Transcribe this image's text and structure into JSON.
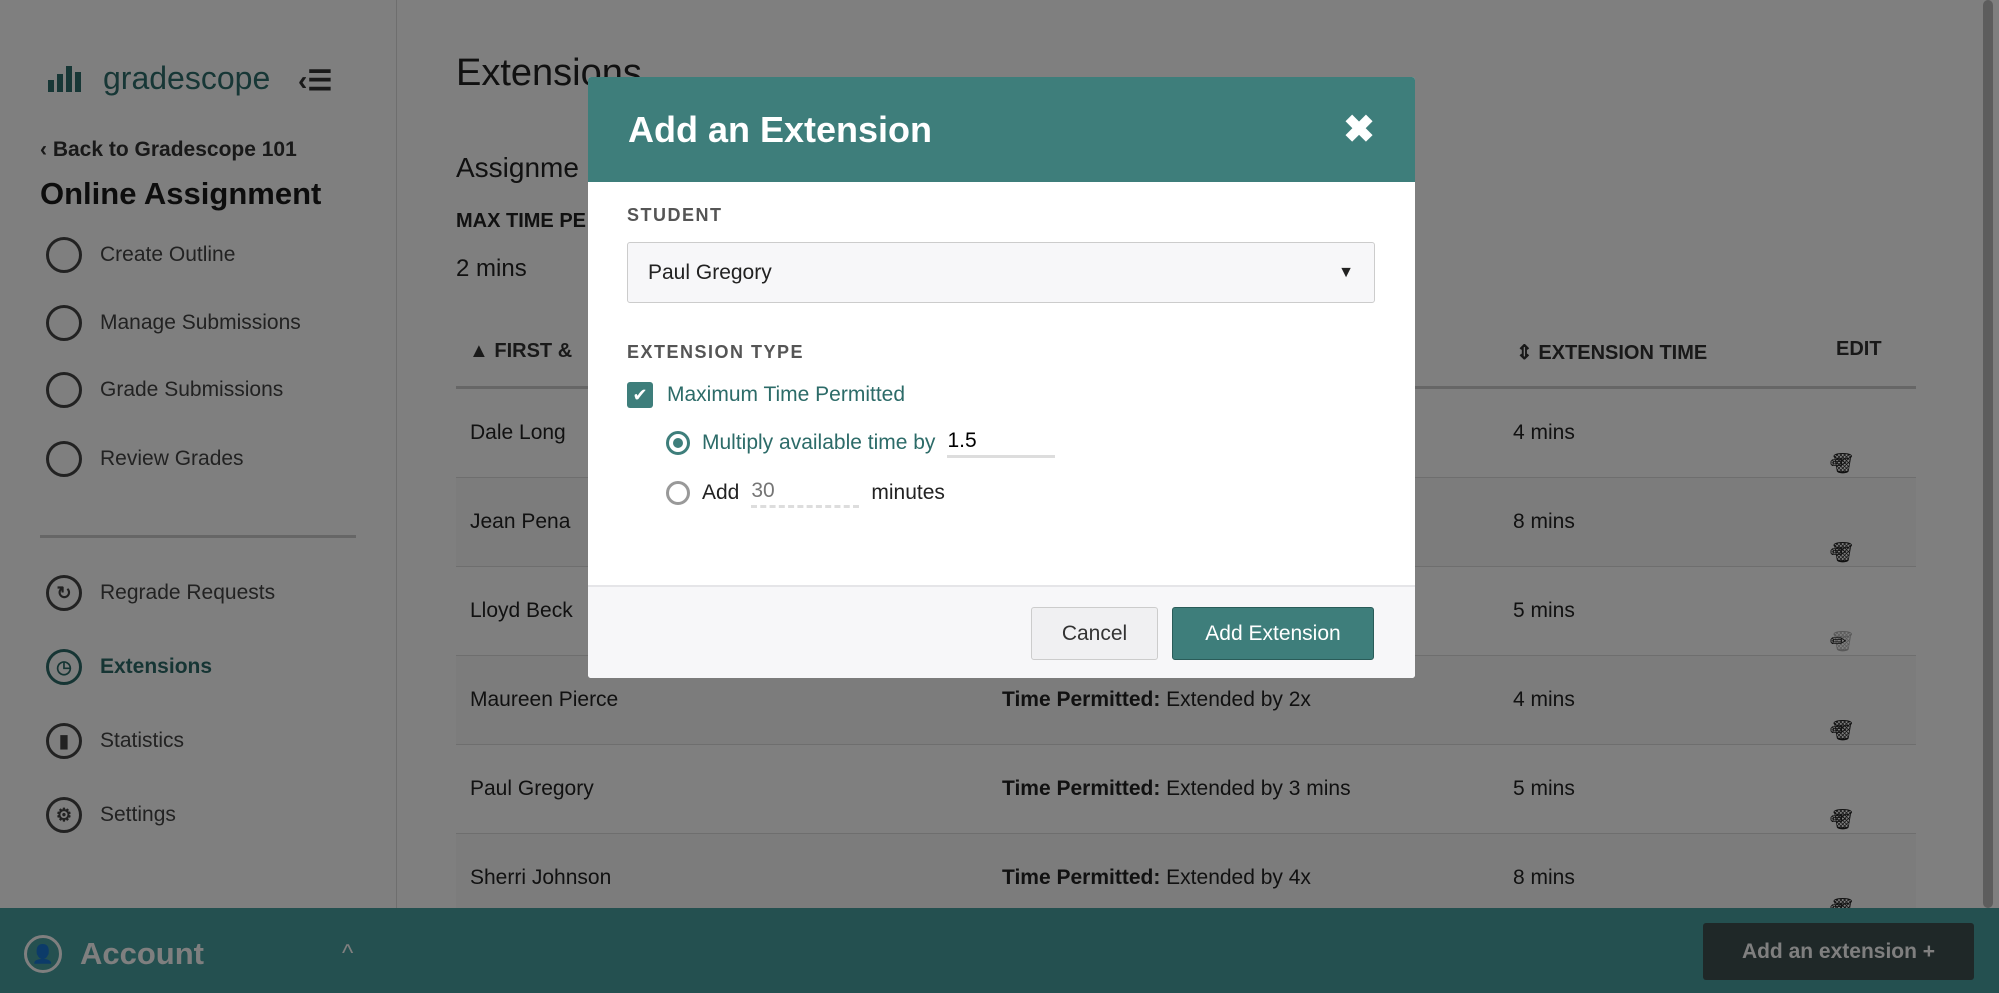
{
  "sidebar": {
    "logo": "gradescope",
    "back": "Back to Gradescope 101",
    "assignment_title": "Online Assignment",
    "steps": [
      "Create Outline",
      "Manage Submissions",
      "Grade Submissions",
      "Review Grades"
    ],
    "tools": [
      {
        "label": "Regrade Requests",
        "icon": "regrade-icon"
      },
      {
        "label": "Extensions",
        "icon": "clock-icon",
        "active": true
      },
      {
        "label": "Statistics",
        "icon": "bar-chart-icon"
      },
      {
        "label": "Settings",
        "icon": "gear-icon"
      }
    ],
    "account": "Account"
  },
  "main": {
    "title": "Extensions",
    "subtitle": "Assignme",
    "max_time_label": "MAX TIME PE",
    "max_time_value": "2 mins",
    "columns": {
      "name": "FIRST &",
      "time": "EXTENSION TIME",
      "edit": "EDIT"
    },
    "rows": [
      {
        "name": "Dale Long",
        "type_bold": "",
        "type": "",
        "time": "4 mins"
      },
      {
        "name": "Jean Pena",
        "type_bold": "",
        "type": "",
        "time": "8 mins"
      },
      {
        "name": "Lloyd Beck",
        "type_bold": "",
        "type": "",
        "time": "5 mins"
      },
      {
        "name": "Maureen Pierce",
        "type_bold": "Time Permitted:",
        "type": "Extended by 2x",
        "time": "4 mins"
      },
      {
        "name": "Paul Gregory",
        "type_bold": "Time Permitted:",
        "type": "Extended by 3 mins",
        "time": "5 mins"
      },
      {
        "name": "Sherri Johnson",
        "type_bold": "Time Permitted:",
        "type": "Extended by 4x",
        "time": "8 mins"
      }
    ],
    "add_button": "Add an extension +"
  },
  "dialog": {
    "title": "Add an Extension",
    "student_label": "STUDENT",
    "student": "Paul Gregory",
    "type_label": "EXTENSION TYPE",
    "checkbox": "Maximum Time Permitted",
    "checked": true,
    "radio_multiply": "Multiply available time by",
    "multiply_value": "1.5",
    "radio_add": "Add",
    "add_placeholder": "30",
    "minutes": "minutes",
    "selected": "multiply",
    "cancel": "Cancel",
    "submit": "Add Extension"
  },
  "colors": {
    "accent": "#3e7e7b"
  }
}
